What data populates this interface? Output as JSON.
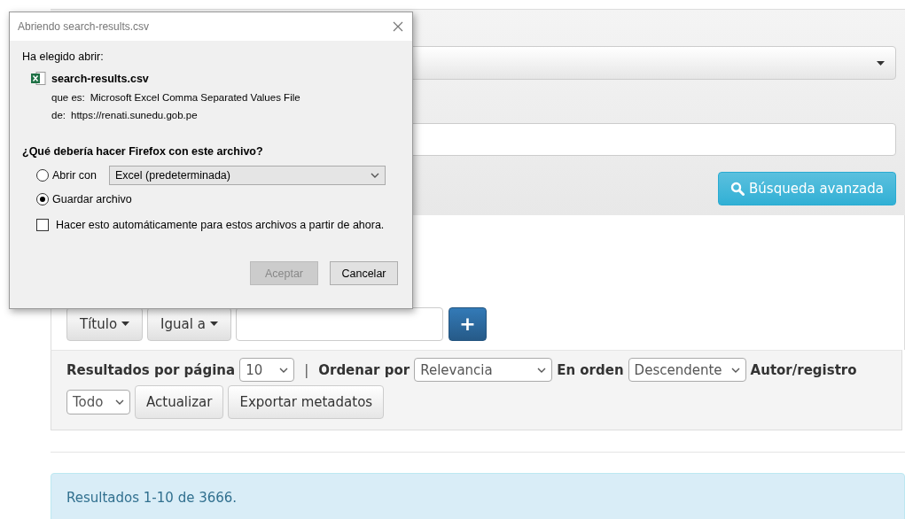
{
  "search_panel": {
    "advanced_button": "Búsqueda avanzada"
  },
  "filter": {
    "field": "Título",
    "operator": "Igual a",
    "add_button": "+"
  },
  "results_controls": {
    "per_page_label": "Resultados por página",
    "per_page": "10",
    "separator": "|",
    "sort_label": "Ordenar por",
    "sort": "Relevancia",
    "order_label": "En orden",
    "order": "Descendente",
    "author_label": "Autor/registro",
    "author": "Todo",
    "update_button": "Actualizar",
    "export_button": "Exportar metadatos"
  },
  "results_alert": "Resultados 1-10 de 3666.",
  "dialog": {
    "title": "Abriendo search-results.csv",
    "intro": "Ha elegido abrir:",
    "file_name": "search-results.csv",
    "type_label": "que es:",
    "type_value": "Microsoft Excel Comma Separated Values File",
    "source_label": "de:",
    "source_value": "https://renati.sunedu.gob.pe",
    "question": "¿Qué debería hacer Firefox con este archivo?",
    "options": [
      {
        "label": "Abrir con",
        "selected": false,
        "app": "Excel (predeterminada)"
      },
      {
        "label": "Guardar archivo",
        "selected": true
      }
    ],
    "auto_checkbox": {
      "label": "Hacer esto automáticamente para estos archivos a partir de ahora.",
      "checked": false
    },
    "buttons": [
      {
        "label": "Aceptar",
        "disabled": true
      },
      {
        "label": "Cancelar",
        "disabled": false
      }
    ]
  }
}
